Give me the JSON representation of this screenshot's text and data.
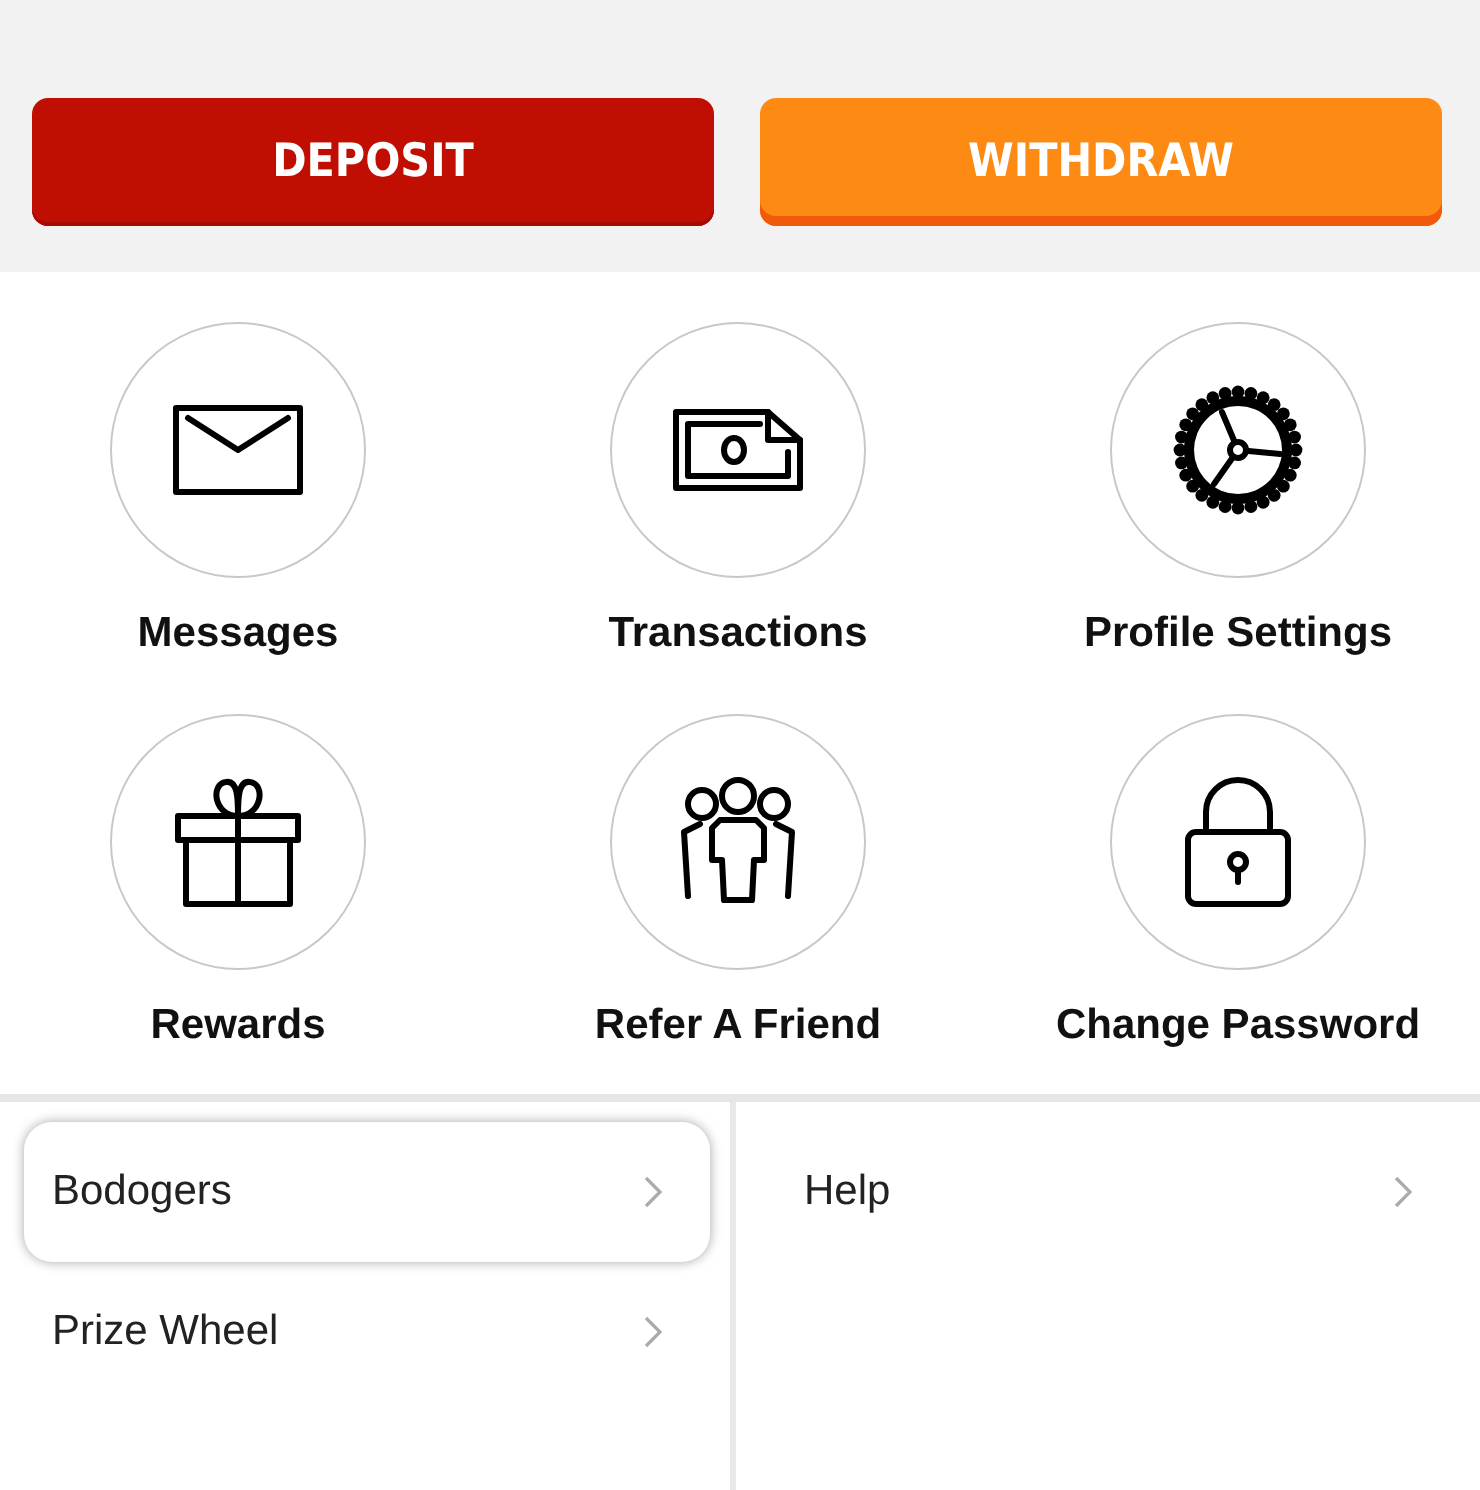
{
  "actions": [
    {
      "label": "DEPOSIT",
      "kind": "primary"
    },
    {
      "label": "WITHDRAW",
      "kind": "secondary"
    }
  ],
  "shortcuts": [
    {
      "label": "Messages"
    },
    {
      "label": "Transactions"
    },
    {
      "label": "Profile Settings"
    },
    {
      "label": "Rewards"
    },
    {
      "label": "Refer A Friend"
    },
    {
      "label": "Change Password"
    }
  ],
  "menu_columns": [
    [
      {
        "label": "Bodogers",
        "selected": true
      },
      {
        "label": "Prize Wheel",
        "selected": false
      }
    ],
    [
      {
        "label": "Help",
        "selected": false
      }
    ]
  ]
}
